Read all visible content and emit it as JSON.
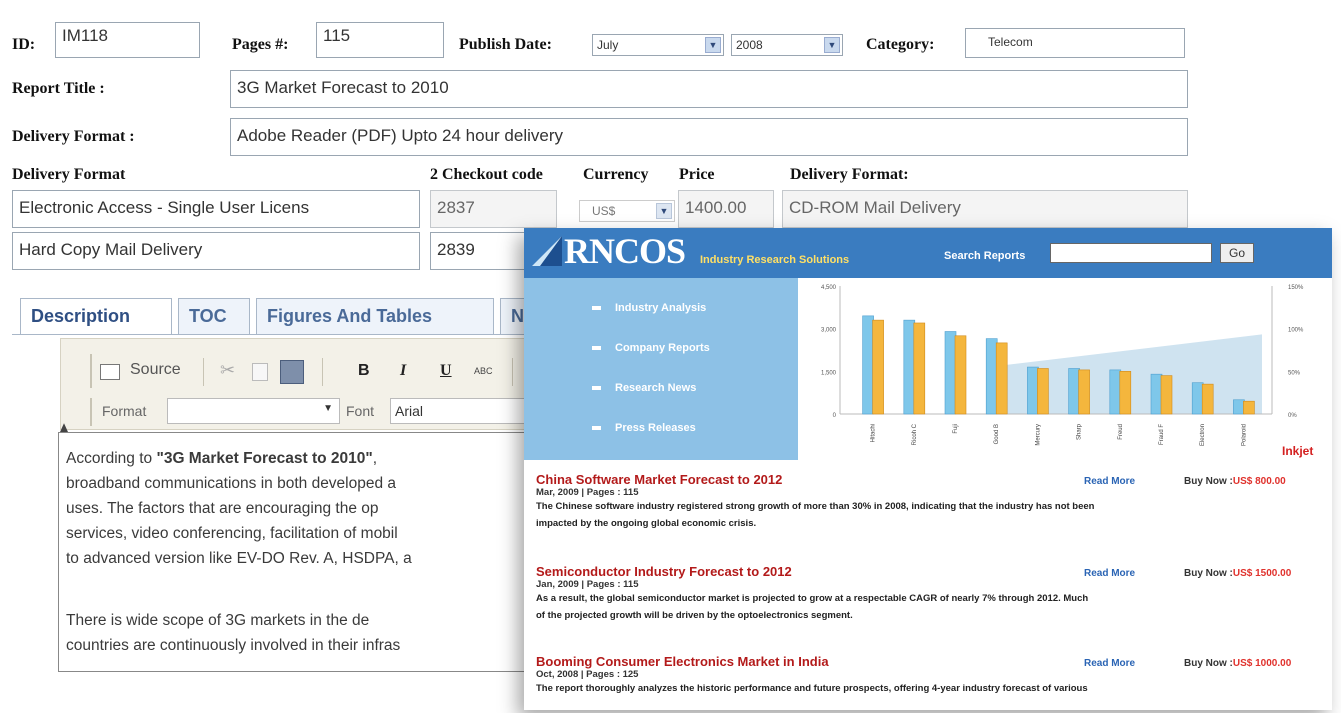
{
  "form": {
    "id_label": "ID:",
    "id_value": "IM118",
    "pages_label": "Pages #:",
    "pages_value": "115",
    "publish_label": "Publish Date:",
    "publish_month": "July",
    "publish_year": "2008",
    "category_label": "Category:",
    "category_value": "Telecom",
    "title_label": "Report Title :",
    "title_value": "3G Market Forecast to 2010",
    "delivery_label": "Delivery Format :",
    "delivery_value": "Adobe Reader (PDF) Upto 24 hour delivery",
    "table": {
      "col_delivery": "Delivery Format",
      "col_checkout": "2 Checkout code",
      "col_currency": "Currency",
      "col_price": "Price",
      "col_delivery2": "Delivery Format:",
      "rows": [
        {
          "format": "Electronic Access - Single User Licens",
          "code": "2837",
          "currency": "US$",
          "price": "1400.00",
          "format2": "CD-ROM Mail Delivery"
        },
        {
          "format": "Hard Copy Mail Delivery",
          "code": "2839"
        }
      ]
    }
  },
  "tabs": [
    {
      "label": "Description"
    },
    {
      "label": "TOC"
    },
    {
      "label": "Figures And Tables"
    },
    {
      "label": "N"
    }
  ],
  "toolbar": {
    "source_label": "Source",
    "bold": "B",
    "italic": "I",
    "underline": "U",
    "strike": "ABC",
    "format_label": "Format",
    "font_label": "Font",
    "font_value": "Arial"
  },
  "editor": {
    "lines": [
      {
        "pre": "According to ",
        "strong": "\"3G Market Forecast to 2010\"",
        "post": ","
      },
      {
        "text": "broadband communications in both developed a"
      },
      {
        "text": "uses. The factors that are encouraging the op"
      },
      {
        "text": "services, video conferencing, facilitation of mobil"
      },
      {
        "text": "to advanced version like EV-DO Rev. A, HSDPA, a"
      },
      {
        "text": "There is wide scope of 3G markets in the de"
      },
      {
        "text": "countries are continuously involved in their infras"
      }
    ]
  },
  "overlay": {
    "brand": "RNCOS",
    "tagline": "Industry Research Solutions",
    "search_label": "Search Reports",
    "go_label": "Go",
    "nav": [
      "Industry Analysis",
      "Company Reports",
      "Research News",
      "Press Releases"
    ],
    "edge_label": "Inkjet",
    "articles": [
      {
        "title": "China Software Market Forecast to 2012",
        "meta": "Mar, 2009 | Pages : 115",
        "body": [
          "The Chinese software industry registered strong growth of more than 30% in 2008, indicating that the industry has not been",
          "impacted by the ongoing global economic crisis."
        ],
        "read_more": "Read More",
        "buy_label": "Buy Now :",
        "price": "US$ 800.00"
      },
      {
        "title": "Semiconductor Industry Forecast to 2012",
        "meta": "Jan, 2009 | Pages : 115",
        "body": [
          "As a result, the global semiconductor market is projected to grow at a respectable CAGR of nearly 7% through 2012. Much",
          "of the projected growth will be driven by the optoelectronics segment."
        ],
        "read_more": "Read More",
        "buy_label": "Buy Now :",
        "price": "US$ 1500.00"
      },
      {
        "title": "Booming Consumer Electronics Market in India",
        "meta": "Oct, 2008 | Pages : 125",
        "body": [
          "The report thoroughly analyzes the historic performance and future prospects, offering 4-year industry forecast of various"
        ],
        "read_more": "Read More",
        "buy_label": "Buy Now :",
        "price": "US$ 1000.00"
      }
    ]
  },
  "chart_data": {
    "type": "bar",
    "yticks_left": [
      "4,500",
      "3,000",
      "1,500",
      "0"
    ],
    "yticks_right": [
      "150%",
      "100%",
      "50%",
      "0%"
    ],
    "ylim": [
      0,
      4500
    ],
    "categories": [
      "Hitachi",
      "Ricoh C",
      "Fuji",
      "Good B",
      "Mercury",
      "Sharp",
      "Freud",
      "Fraud F",
      "Electron",
      "Polaroid"
    ],
    "series": [
      {
        "values": [
          3450,
          3300,
          2900,
          2650,
          1650,
          1600,
          1550,
          1400,
          1100,
          500
        ]
      },
      {
        "values": [
          3300,
          3200,
          2750,
          2500,
          1600,
          1550,
          1500,
          1350,
          1050,
          450
        ]
      }
    ],
    "colors": {
      "series1": "#7ec7ea",
      "series2": "#f4b63d",
      "area": "#cfe3f0"
    }
  }
}
